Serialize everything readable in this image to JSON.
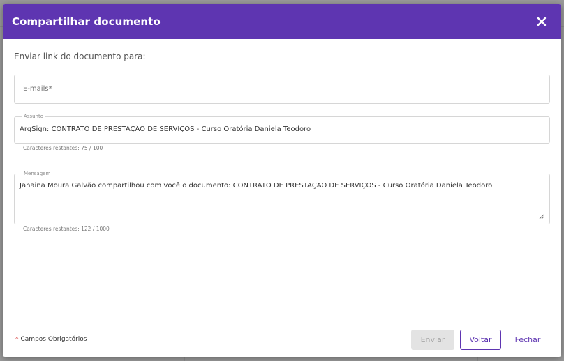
{
  "dialog": {
    "title": "Compartilhar documento",
    "close_icon": "close-icon"
  },
  "form": {
    "intro": "Enviar link do documento para:",
    "emails": {
      "placeholder": "E-mails*",
      "value": ""
    },
    "subject": {
      "label": "Assunto",
      "value": "ArqSign: CONTRATO DE PRESTAÇÃO DE SERVIÇOS - Curso Oratória Daniela Teodoro",
      "helper": "Caracteres restantes: 75 / 100"
    },
    "message": {
      "label": "Mensagem",
      "value": "Janaina Moura Galvão compartilhou com você o documento: CONTRATO DE PRESTAÇAO DE SERVIÇOS - Curso Oratória Daniela Teodoro",
      "helper": "Caracteres restantes: 122 / 1000"
    }
  },
  "footer": {
    "required_asterisk": "*",
    "required_note": "Campos Obrigatórios",
    "send_label": "Enviar",
    "back_label": "Voltar",
    "close_label": "Fechar"
  },
  "colors": {
    "primary": "#5e35b1",
    "required": "#d32f2f",
    "disabled_bg": "#e3e3e3"
  }
}
